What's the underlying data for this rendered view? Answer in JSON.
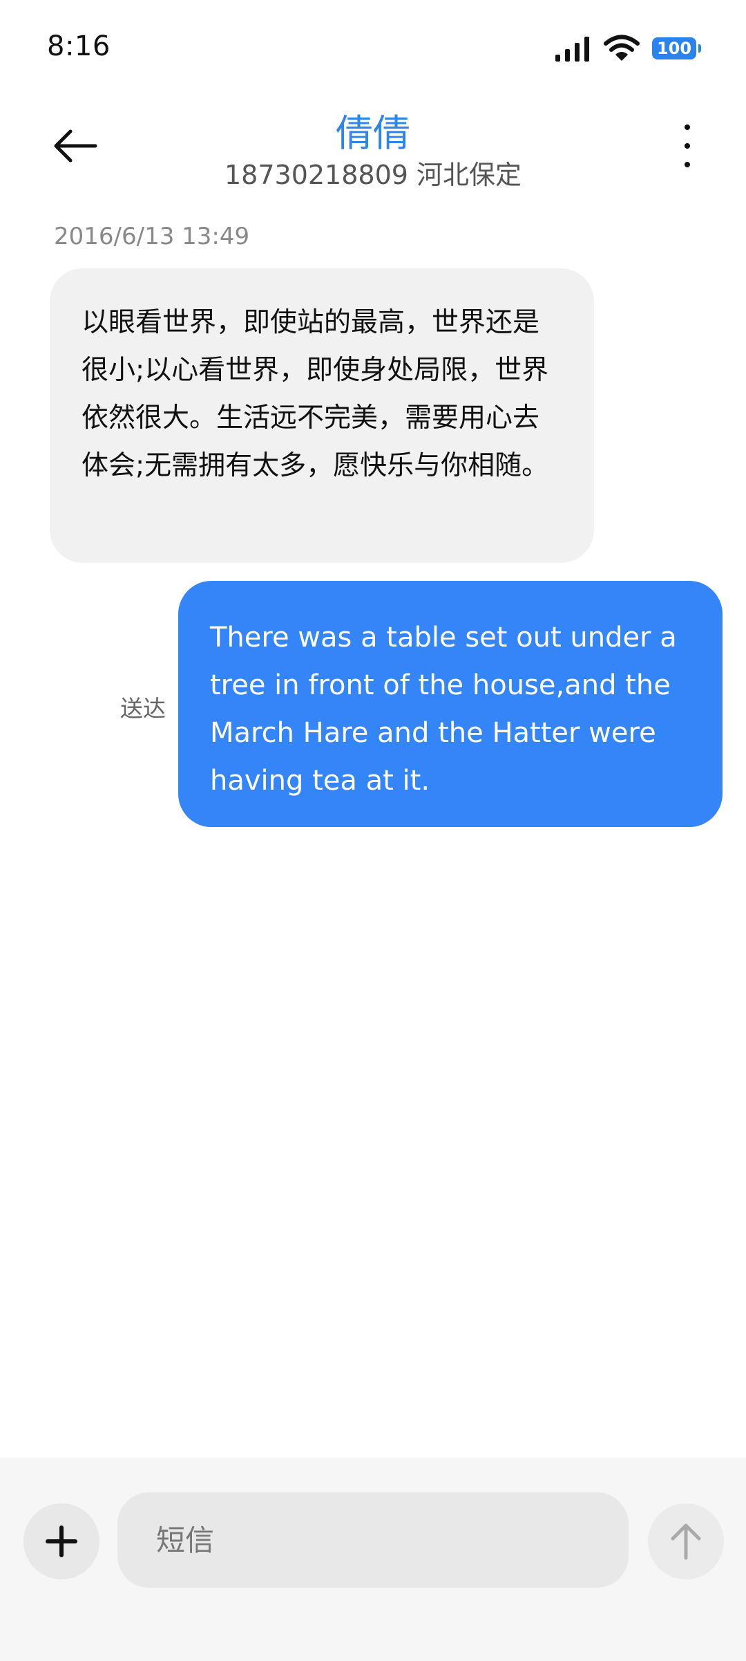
{
  "status_bar": {
    "time": "8:16",
    "battery": "100",
    "icons": [
      "signal-icon",
      "wifi-icon",
      "battery-icon"
    ]
  },
  "header": {
    "contact_name": "倩倩",
    "contact_number_location": "18730218809 河北保定",
    "back_icon": "arrow-left-icon",
    "more_icon": "more-vertical-icon"
  },
  "conversation": {
    "timestamp": "2016/6/13 13:49",
    "received_message": "以眼看世界，即使站的最高，世界还是很小;以心看世界，即使身处局限，世界依然很大。生活远不完美，需要用心去体会;无需拥有太多，愿快乐与你相随。",
    "sent_message": "There was a table set out under a tree in front of the house,and the March Hare and the Hatter were having tea at it.",
    "sent_status": "送达"
  },
  "composer": {
    "placeholder": "短信",
    "value": "",
    "add_icon": "plus-icon",
    "send_icon": "arrow-up-icon"
  },
  "colors": {
    "accent": "#2f86e6",
    "sent_bubble": "#3485f7",
    "received_bubble": "#f1f1f1"
  }
}
